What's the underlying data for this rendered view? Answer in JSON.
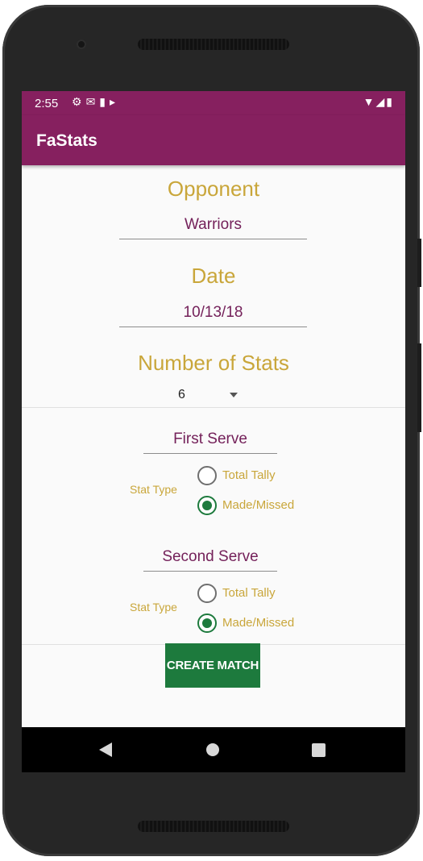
{
  "status_bar": {
    "time": "2:55",
    "left_icons": [
      "settings-icon",
      "gmail-icon",
      "sd-card-icon",
      "play-store-icon"
    ],
    "right_icons": [
      "wifi-icon",
      "signal-icon",
      "battery-icon"
    ]
  },
  "app": {
    "title": "FaStats",
    "primary_color": "#86205f",
    "accent_color": "#c9a63a",
    "button_color": "#1d7a3d"
  },
  "form": {
    "opponent_heading": "Opponent",
    "opponent_value": "Warriors",
    "date_heading": "Date",
    "date_value": "10/13/18",
    "num_stats_heading": "Number of Stats",
    "num_stats_value": "6"
  },
  "stats": [
    {
      "name": "First Serve",
      "type_label": "Stat Type",
      "options": [
        {
          "label": "Total Tally",
          "selected": false
        },
        {
          "label": "Made/Missed",
          "selected": true
        }
      ]
    },
    {
      "name": "Second Serve",
      "type_label": "Stat Type",
      "options": [
        {
          "label": "Total Tally",
          "selected": false
        },
        {
          "label": "Made/Missed",
          "selected": true
        }
      ]
    }
  ],
  "actions": {
    "create_match_label": "CREATE MATCH"
  }
}
